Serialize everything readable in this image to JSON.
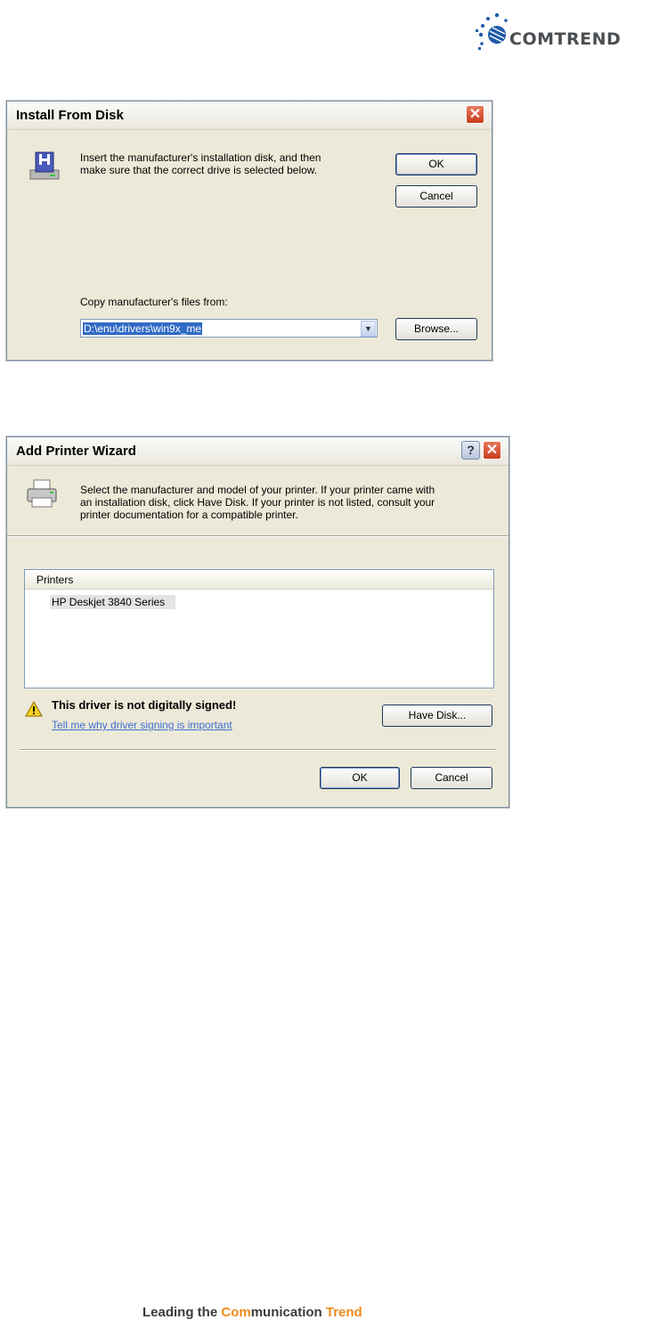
{
  "brand": {
    "logo_text": "COMTREND",
    "footer": {
      "part1": "Leading the ",
      "part2_accent": "Com",
      "part3": "munication ",
      "part4_accent": "Trend"
    },
    "colors": {
      "logo_blue": "#1e5aa8",
      "accent_orange": "#f08a1c"
    }
  },
  "install_dialog": {
    "title": "Install From Disk",
    "icon": "floppy-disk-drive-icon",
    "message_line1": "Insert the manufacturer's installation disk, and then",
    "message_line2": "make sure that the correct drive is selected below.",
    "ok_label": "OK",
    "cancel_label": "Cancel",
    "copy_from_label": "Copy manufacturer's files from:",
    "path_value": "D:\\enu\\drivers\\win9x_me",
    "browse_label": "Browse..."
  },
  "printer_wizard": {
    "title": "Add Printer Wizard",
    "icon": "printer-icon",
    "message_line1": "Select the manufacturer and model of your printer. If your printer came with",
    "message_line2": "an installation disk, click Have Disk. If your printer is not listed, consult your",
    "message_line3": "printer documentation for a compatible printer.",
    "list_header": "Printers",
    "list_items": [
      "HP Deskjet 3840 Series"
    ],
    "warning_text": "This driver is not digitally signed!",
    "warning_link": "Tell me why driver signing is important",
    "have_disk_label": "Have Disk...",
    "ok_label": "OK",
    "cancel_label": "Cancel"
  }
}
